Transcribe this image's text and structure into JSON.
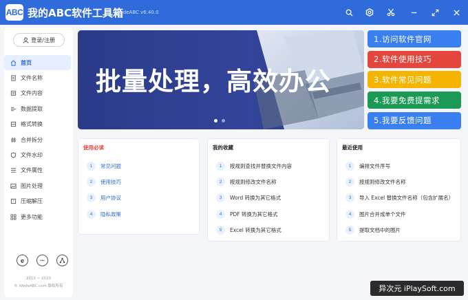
{
  "titlebar": {
    "logo": "ABC",
    "title": "我的ABC软件工具箱",
    "version": "WodeABC v6.40.0",
    "icons": [
      "search-icon",
      "settings-icon",
      "scissors-icon",
      "minimize-icon",
      "maximize-icon",
      "close-icon"
    ]
  },
  "sidebar": {
    "login_label": "登录/注册",
    "items": [
      {
        "label": "首页",
        "icon": "home-icon"
      },
      {
        "label": "文件名称",
        "icon": "file-name-icon"
      },
      {
        "label": "文件内容",
        "icon": "file-content-icon"
      },
      {
        "label": "数据提取",
        "icon": "data-extract-icon"
      },
      {
        "label": "格式转换",
        "icon": "format-convert-icon"
      },
      {
        "label": "合并拆分",
        "icon": "merge-split-icon"
      },
      {
        "label": "文件水印",
        "icon": "watermark-icon"
      },
      {
        "label": "文件属性",
        "icon": "properties-icon"
      },
      {
        "label": "图片处理",
        "icon": "image-icon"
      },
      {
        "label": "压缩解压",
        "icon": "compress-icon"
      },
      {
        "label": "更多功能",
        "icon": "more-icon"
      }
    ],
    "bottom_icons": [
      "ie-icon",
      "chat-icon",
      "share-icon"
    ],
    "footer_years": "2013 ~ 2023",
    "footer_copyright": "© WodeABC.com 版权所有"
  },
  "banner": {
    "text": "批量处理，高效办公",
    "dots": 2
  },
  "quick_links": [
    {
      "label": "1.访问软件官网",
      "color": "#3a7ff0"
    },
    {
      "label": "2.软件使用技巧",
      "color": "#e2463c"
    },
    {
      "label": "3.软件常见问题",
      "color": "#f5b400"
    },
    {
      "label": "4.我要免费提需求",
      "color": "#1a9a54"
    },
    {
      "label": "5.我要反馈问题",
      "color": "#3a7ff0"
    }
  ],
  "panels": {
    "must_read": {
      "title": "使用必读",
      "title_color": "#e2463c",
      "items": [
        "常见问题",
        "使用技巧",
        "用户协议",
        "隐私政策"
      ]
    },
    "favorites": {
      "title": "我的收藏",
      "items": [
        "按规则查找并替换文件内容",
        "按规则修改文件名称",
        "Word 转换为其它格式",
        "PDF 转换为其它格式",
        "Excel 转换为其它格式"
      ]
    },
    "recent": {
      "title": "最近使用",
      "items": [
        "编排文件序号",
        "按规则修改文件名称",
        "导入 Excel 替换文件名称（包含扩展名）",
        "图片合并成单个文件",
        "提取文档中的图片"
      ]
    }
  },
  "watermark": "异次元 iPlaySoft.com"
}
